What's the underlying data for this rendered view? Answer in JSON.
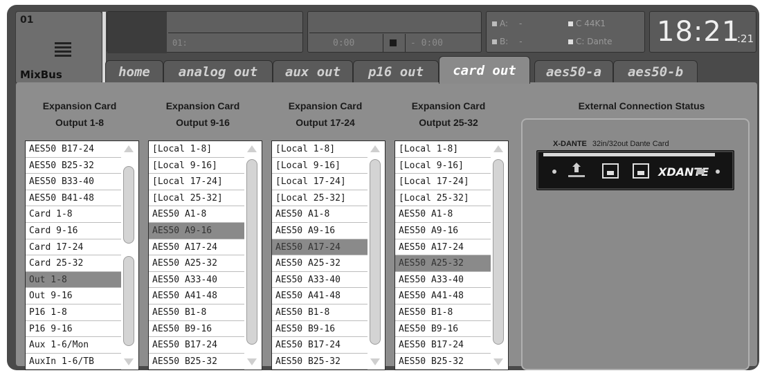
{
  "header": {
    "channel_number": "01",
    "channel_name": "MixBus",
    "scene_text": "01:",
    "time_elapsed": "0:00",
    "time_remaining": "- 0:00",
    "sync": {
      "a_label": "A:",
      "a_value": "-",
      "b_label": "B:",
      "b_value": "-",
      "rate": "C 44K1",
      "source": "C: Dante"
    },
    "clock_hm": "18:21",
    "clock_sec": ":21"
  },
  "tabs": [
    {
      "label": "home"
    },
    {
      "label": "analog out"
    },
    {
      "label": "aux out"
    },
    {
      "label": "p16 out"
    },
    {
      "label": "card out"
    },
    {
      "label": "aes50-a"
    },
    {
      "label": "aes50-b"
    }
  ],
  "active_tab": "card out",
  "columns": [
    {
      "title_line1": "Expansion Card",
      "title_line2": "Output 1-8",
      "selected": "Out 1-8",
      "items": [
        "AES50 B17-24",
        "AES50 B25-32",
        "AES50 B33-40",
        "AES50 B41-48",
        "Card 1-8",
        "Card 9-16",
        "Card 17-24",
        "Card 25-32",
        "Out 1-8",
        "Out 9-16",
        "P16 1-8",
        "P16 9-16",
        "Aux 1-6/Mon",
        "AuxIn 1-6/TB"
      ]
    },
    {
      "title_line1": "Expansion Card",
      "title_line2": "Output 9-16",
      "selected": "AES50 A9-16",
      "items": [
        "[Local 1-8]",
        "[Local 9-16]",
        "[Local 17-24]",
        "[Local 25-32]",
        "AES50 A1-8",
        "AES50 A9-16",
        "AES50 A17-24",
        "AES50 A25-32",
        "AES50 A33-40",
        "AES50 A41-48",
        "AES50 B1-8",
        "AES50 B9-16",
        "AES50 B17-24",
        "AES50 B25-32"
      ]
    },
    {
      "title_line1": "Expansion Card",
      "title_line2": "Output 17-24",
      "selected": "AES50 A17-24",
      "items": [
        "[Local 1-8]",
        "[Local 9-16]",
        "[Local 17-24]",
        "[Local 25-32]",
        "AES50 A1-8",
        "AES50 A9-16",
        "AES50 A17-24",
        "AES50 A25-32",
        "AES50 A33-40",
        "AES50 A41-48",
        "AES50 B1-8",
        "AES50 B9-16",
        "AES50 B17-24",
        "AES50 B25-32"
      ]
    },
    {
      "title_line1": "Expansion Card",
      "title_line2": "Output 25-32",
      "selected": "AES50 A25-32",
      "items": [
        "[Local 1-8]",
        "[Local 9-16]",
        "[Local 17-24]",
        "[Local 25-32]",
        "AES50 A1-8",
        "AES50 A9-16",
        "AES50 A17-24",
        "AES50 A25-32",
        "AES50 A33-40",
        "AES50 A41-48",
        "AES50 B1-8",
        "AES50 B9-16",
        "AES50 B17-24",
        "AES50 B25-32"
      ]
    }
  ],
  "status": {
    "title": "External Connection Status",
    "card_name": "X-DANTE",
    "card_desc": "32in/32out Dante Card",
    "card_brand": "XDANTE"
  },
  "colors": {
    "frame": "#4a4a4a",
    "content": "#8d8d8d",
    "selected_row": "#8a8a8a",
    "sync_dot": "#bcbcbc"
  }
}
